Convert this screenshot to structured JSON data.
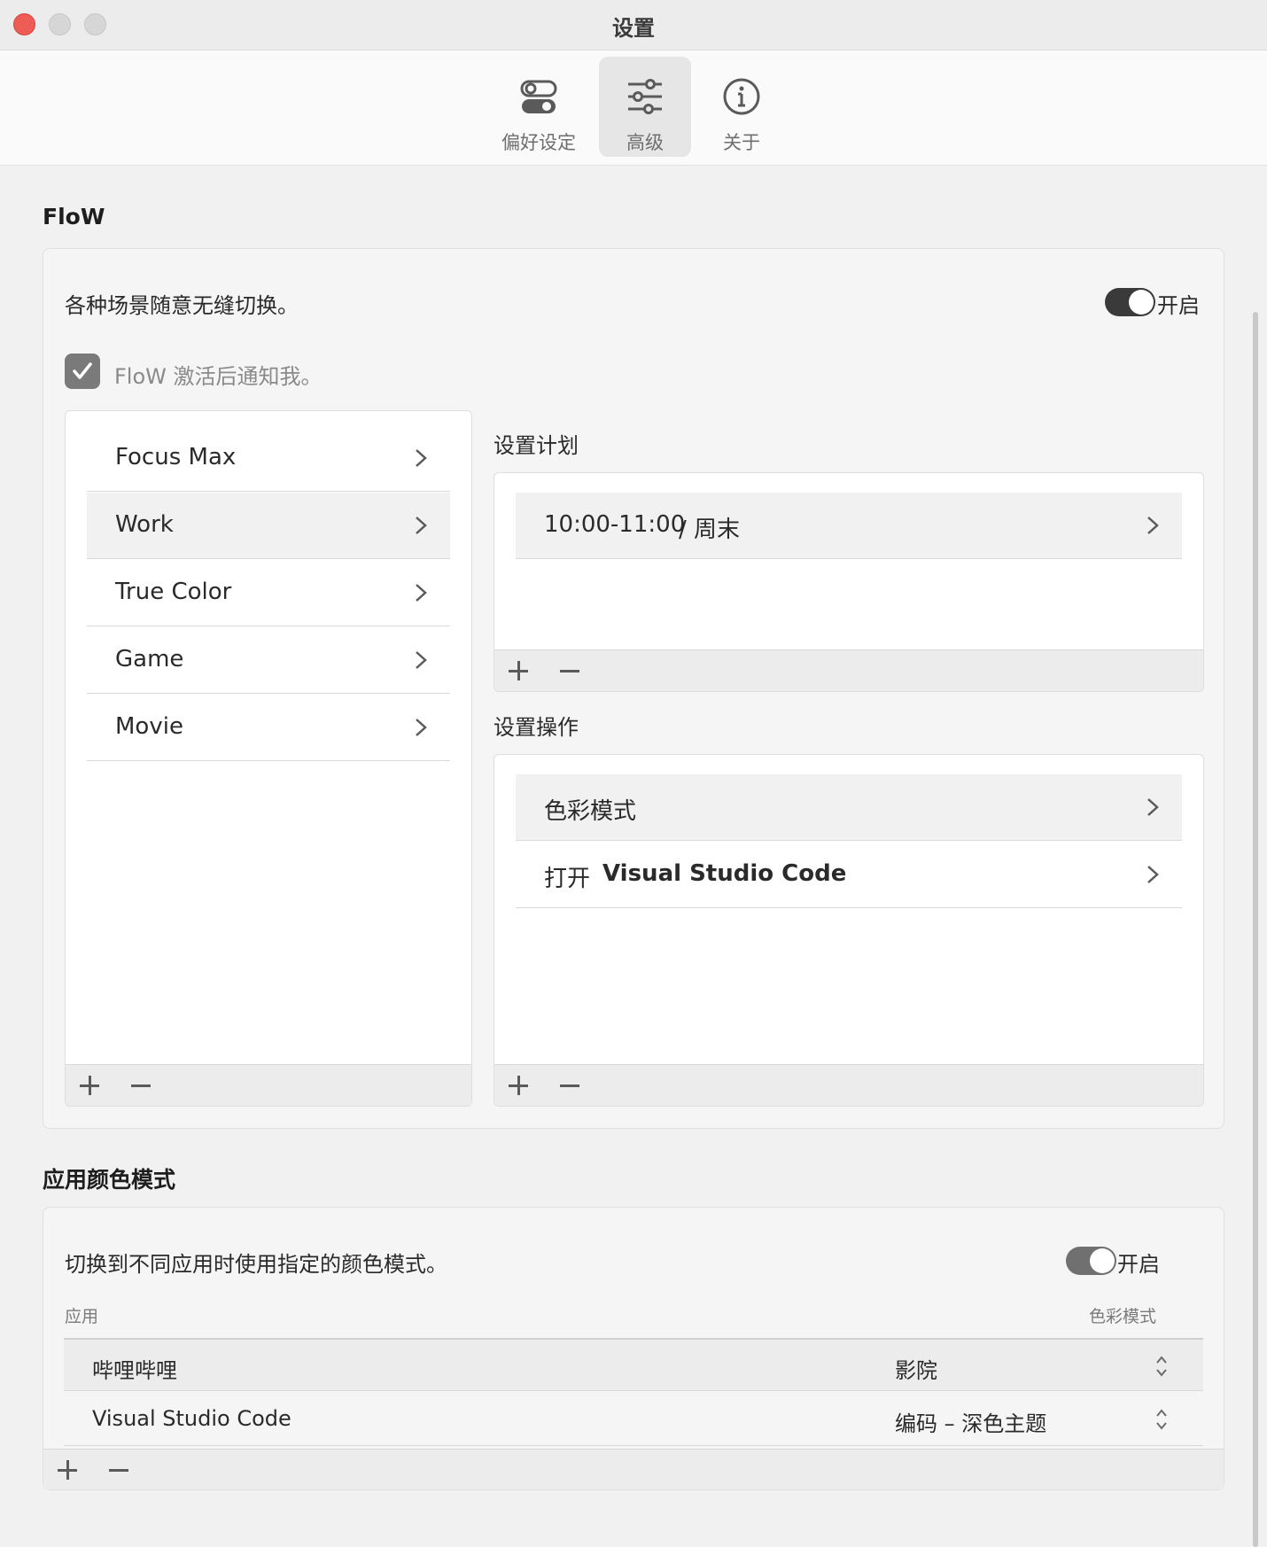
{
  "window": {
    "title": "设置"
  },
  "toolbar": {
    "items": [
      {
        "label": "偏好设定",
        "icon": "toggles-icon"
      },
      {
        "label": "高级",
        "icon": "sliders-icon",
        "active": true
      },
      {
        "label": "关于",
        "icon": "info-icon"
      }
    ]
  },
  "flow": {
    "title": "FloW",
    "description": "各种场景随意无缝切换。",
    "toggle_label": "开启",
    "toggle_on": true,
    "notify_label": "FloW 激活后通知我。",
    "notify_checked": true,
    "scenes": [
      "Focus Max",
      "Work",
      "True Color",
      "Game",
      "Movie"
    ],
    "selected_scene": "Work",
    "schedule_title": "设置计划",
    "schedule_items": [
      {
        "time": "10:00-11:00",
        "days": "/ 周末"
      }
    ],
    "actions_title": "设置操作",
    "actions": [
      {
        "label": "色彩模式"
      },
      {
        "prefix": "打开",
        "label": "Visual Studio Code"
      }
    ]
  },
  "app_color": {
    "title": "应用颜色模式",
    "description": "切换到不同应用时使用指定的颜色模式。",
    "toggle_label": "开启",
    "toggle_on": true,
    "col_app": "应用",
    "col_mode": "色彩模式",
    "rows": [
      {
        "app": "哔哩哔哩",
        "mode": "影院"
      },
      {
        "app": "Visual Studio Code",
        "mode": "编码 – 深色主题"
      }
    ]
  },
  "colors": {
    "close": "#ed5c55",
    "toggle_on": "#3a3a3a",
    "checkbox": "#7a7a7a"
  }
}
